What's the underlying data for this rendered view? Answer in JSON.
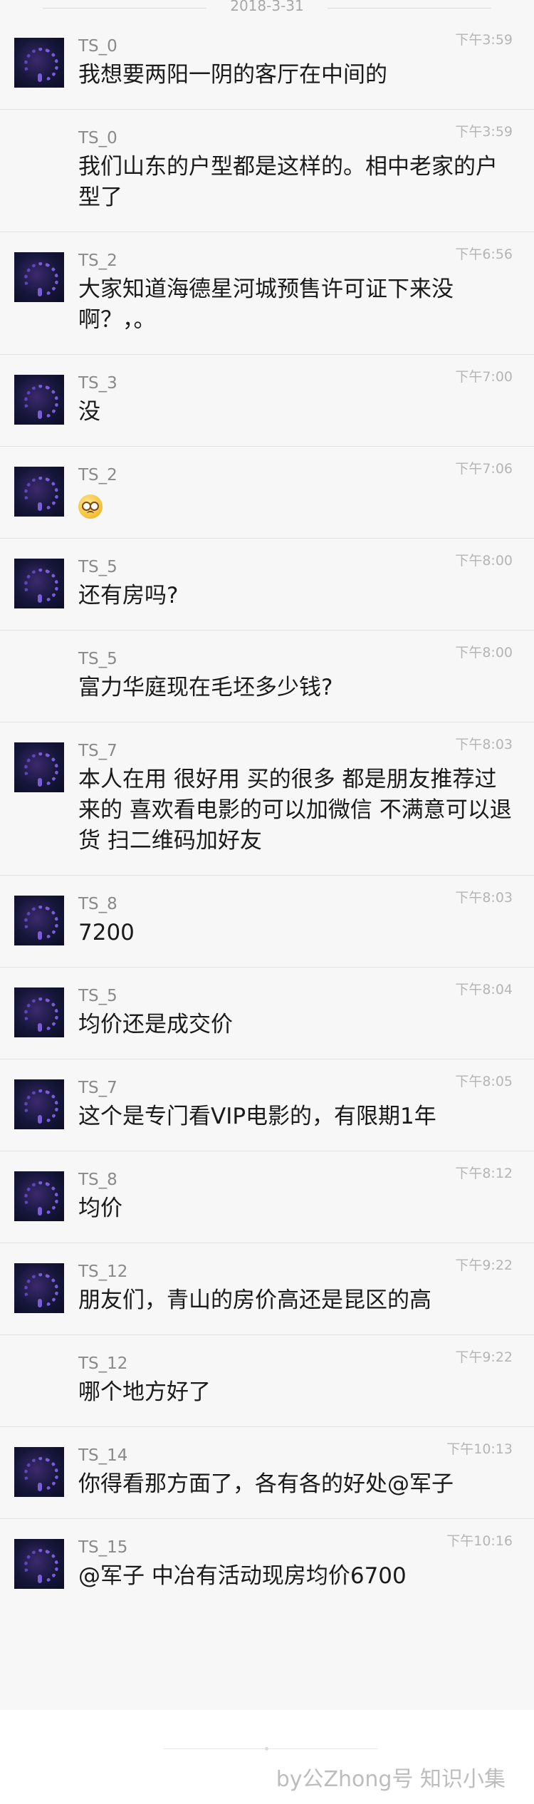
{
  "date_separator": "2018-3-31",
  "messages": [
    {
      "name": "TS_0",
      "time": "下午3:59",
      "text": "我想要两阳一阴的客厅在中间的",
      "avatar": true
    },
    {
      "name": "TS_0",
      "time": "下午3:59",
      "text": "我们山东的户型都是这样的。相中老家的户型了",
      "avatar": false
    },
    {
      "name": "TS_2",
      "time": "下午6:56",
      "text": "大家知道海德星河城预售许可证下来没啊？，。",
      "avatar": true
    },
    {
      "name": "TS_3",
      "time": "下午7:00",
      "text": "没",
      "avatar": true
    },
    {
      "name": "TS_2",
      "time": "下午7:06",
      "text": "",
      "emoji": "face-emoji",
      "avatar": true
    },
    {
      "name": "TS_5",
      "time": "下午8:00",
      "text": "还有房吗?",
      "avatar": true
    },
    {
      "name": "TS_5",
      "time": "下午8:00",
      "text": "富力华庭现在毛坯多少钱?",
      "avatar": false
    },
    {
      "name": "TS_7",
      "time": "下午8:03",
      "text": "本人在用  很好用   买的很多  都是朋友推荐过来的  喜欢看电影的可以加微信  不满意可以退货 扫二维码加好友",
      "avatar": true
    },
    {
      "name": "TS_8",
      "time": "下午8:03",
      "text": "7200",
      "avatar": true
    },
    {
      "name": "TS_5",
      "time": "下午8:04",
      "text": "均价还是成交价",
      "avatar": true
    },
    {
      "name": "TS_7",
      "time": "下午8:05",
      "text": "这个是专门看VIP电影的，有限期1年",
      "avatar": true
    },
    {
      "name": "TS_8",
      "time": "下午8:12",
      "text": "均价",
      "avatar": true
    },
    {
      "name": "TS_12",
      "time": "下午9:22",
      "text": "朋友们，青山的房价高还是昆区的高",
      "avatar": true
    },
    {
      "name": "TS_12",
      "time": "下午9:22",
      "text": "哪个地方好了",
      "avatar": false
    },
    {
      "name": "TS_14",
      "time": "下午10:13",
      "text": "你得看那方面了，各有各的好处@军子",
      "avatar": true
    },
    {
      "name": "TS_15",
      "time": "下午10:16",
      "text": "@军子 中冶有活动现房均价6700",
      "avatar": true
    }
  ],
  "footer": {
    "watermark": "by公Zhong号 知识小集"
  }
}
